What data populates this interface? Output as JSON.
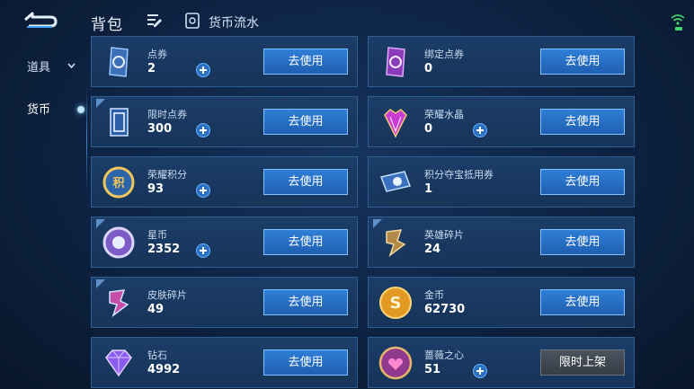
{
  "header": {
    "title": "背包",
    "flow_link": "货币流水"
  },
  "sidebar": {
    "items": [
      {
        "label": "道具"
      },
      {
        "label": "货币"
      }
    ]
  },
  "cards": [
    {
      "name": "点券",
      "count": "2",
      "button": "去使用",
      "icon": "ticket-card-icon"
    },
    {
      "name": "绑定点券",
      "count": "0",
      "button": "去使用",
      "icon": "bound-ticket-icon"
    },
    {
      "name": "限时点券",
      "count": "300",
      "button": "去使用",
      "icon": "limited-ticket-icon"
    },
    {
      "name": "荣耀水晶",
      "count": "0",
      "button": "去使用",
      "icon": "glory-crystal-icon"
    },
    {
      "name": "荣耀积分",
      "count": "93",
      "button": "去使用",
      "icon": "glory-points-icon"
    },
    {
      "name": "积分夺宝抵用券",
      "count": "1",
      "button": "去使用",
      "icon": "voucher-icon"
    },
    {
      "name": "星币",
      "count": "2352",
      "button": "去使用",
      "icon": "star-coin-icon"
    },
    {
      "name": "英雄碎片",
      "count": "24",
      "button": "去使用",
      "icon": "hero-fragment-icon"
    },
    {
      "name": "皮肤碎片",
      "count": "49",
      "button": "去使用",
      "icon": "skin-fragment-icon"
    },
    {
      "name": "金币",
      "count": "62730",
      "button": "去使用",
      "icon": "gold-coin-icon"
    },
    {
      "name": "钻石",
      "count": "4992",
      "button": "去使用",
      "icon": "diamond-icon"
    },
    {
      "name": "蔷薇之心",
      "count": "51",
      "button": "限时上架",
      "icon": "rose-heart-icon"
    }
  ]
}
